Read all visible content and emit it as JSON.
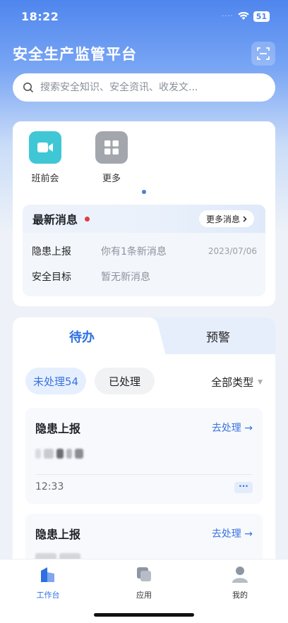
{
  "status_bar": {
    "time": "18:22",
    "signal_dots": "····",
    "battery": "51"
  },
  "header": {
    "title": "安全生产监管平台"
  },
  "search": {
    "placeholder": "搜索安全知识、安全资讯、收发文..."
  },
  "quick_actions": [
    {
      "label": "班前会",
      "icon": "video-camera-icon",
      "color": "#3fc7d6"
    },
    {
      "label": "更多",
      "icon": "grid-more-icon",
      "color": "#9a9ea4"
    }
  ],
  "news": {
    "title": "最新消息",
    "more_label": "更多消息",
    "items": [
      {
        "category": "隐患上报",
        "message": "你有1条新消息",
        "date": "2023/07/06"
      },
      {
        "category": "安全目标",
        "message": "暂无新消息",
        "date": ""
      }
    ]
  },
  "tabs": {
    "active": "待办",
    "inactive": "预警"
  },
  "filters": {
    "unprocessed": "未处理54",
    "processed": "已处理",
    "type_select": "全部类型"
  },
  "todos": [
    {
      "title": "隐患上报",
      "action": "去处理",
      "time": "12:33",
      "more": "···"
    },
    {
      "title": "隐患上报",
      "action": "去处理"
    }
  ],
  "tabbar": [
    {
      "label": "工作台",
      "icon": "workbench-icon",
      "active": true
    },
    {
      "label": "应用",
      "icon": "apps-icon",
      "active": false
    },
    {
      "label": "我的",
      "icon": "profile-icon",
      "active": false
    }
  ],
  "colors": {
    "accent": "#3b73df",
    "header_gradient_top": "#4f86ee",
    "alert": "#e23d3d"
  }
}
